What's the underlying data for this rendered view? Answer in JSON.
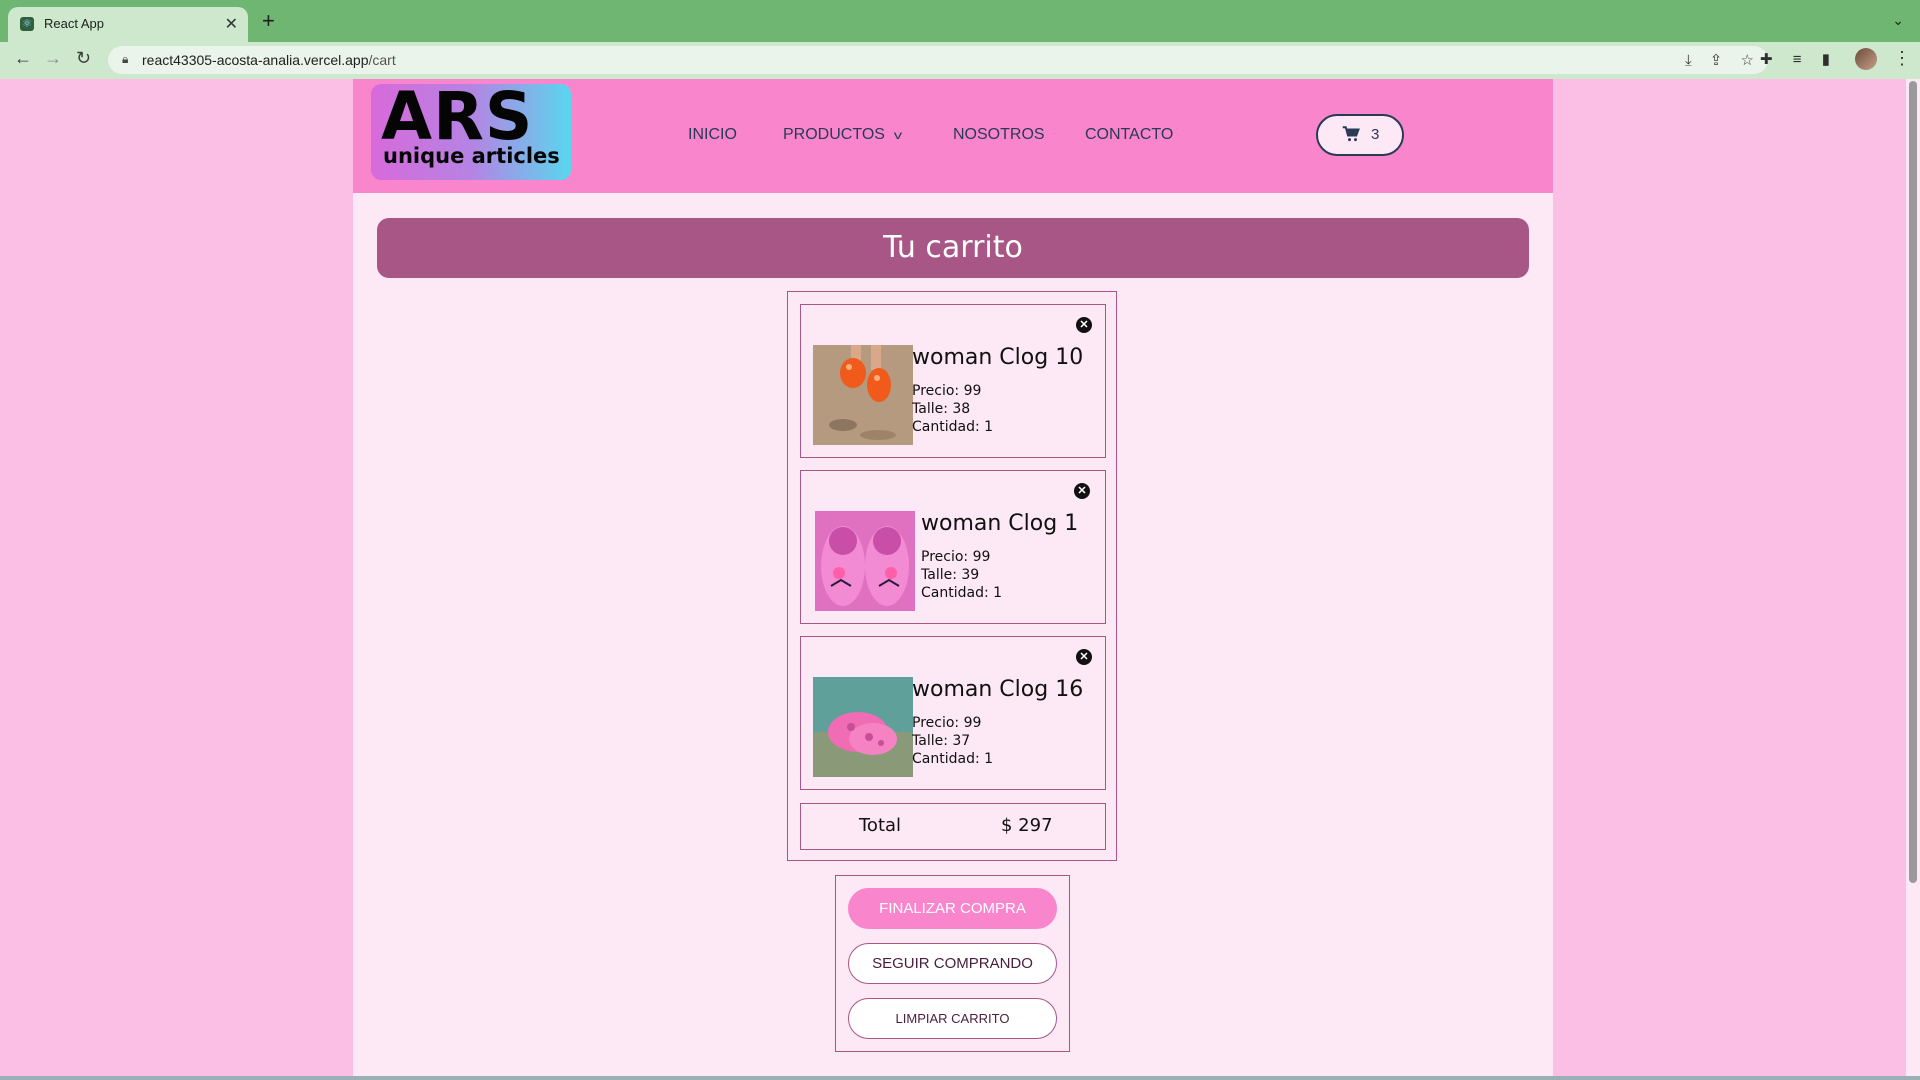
{
  "browser": {
    "tab_title": "React App",
    "tab_close": "✕",
    "new_tab": "+",
    "tab_menu": "⌄",
    "url_host": "react43305-acosta-analia.vercel.app",
    "url_path": "/cart"
  },
  "header": {
    "logo_big": "ARS",
    "logo_small": "unique articles",
    "nav": {
      "inicio": "INICIO",
      "productos": "PRODUCTOS",
      "nosotros": "NOSOTROS",
      "contacto": "CONTACTO"
    },
    "cart_count": "3"
  },
  "main": {
    "title": "Tu carrito",
    "items": [
      {
        "name": "woman Clog 10",
        "precio": "Precio: 99",
        "talle": "Talle: 38",
        "cantidad": "Cantidad: 1",
        "thumb_icon": "orange-clog-photo"
      },
      {
        "name": "woman Clog 1",
        "precio": "Precio: 99",
        "talle": "Talle: 39",
        "cantidad": "Cantidad: 1",
        "thumb_icon": "pink-clog-pair-photo"
      },
      {
        "name": "woman Clog 16",
        "precio": "Precio: 99",
        "talle": "Talle: 37",
        "cantidad": "Cantidad: 1",
        "thumb_icon": "pink-clog-photo"
      }
    ],
    "total_label": "Total",
    "total_value": "$ 297",
    "actions": {
      "finalizar": "FINALIZAR COMPRA",
      "seguir": "SEGUIR COMPRANDO",
      "limpiar": "LIMPIAR CARRITO"
    }
  },
  "colors": {
    "page_bg": "#fbbfe6",
    "header_bg": "#f986cd",
    "banner": "#a85685",
    "nav_text": "#2a3a52"
  }
}
